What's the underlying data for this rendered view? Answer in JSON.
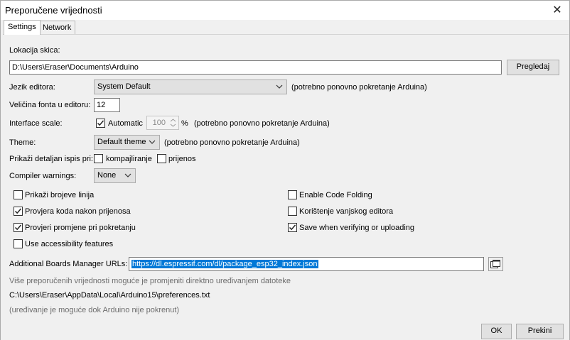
{
  "window": {
    "title": "Preporučene vrijednosti"
  },
  "tabs": [
    {
      "label": "Settings",
      "active": true
    },
    {
      "label": "Network",
      "active": false
    }
  ],
  "sketchbook": {
    "label": "Lokacija skica:",
    "value": "D:\\Users\\Eraser\\Documents\\Arduino",
    "browse_label": "Pregledaj"
  },
  "language": {
    "label": "Jezik editora:",
    "value": "System Default",
    "note": "(potrebno ponovno pokretanje Arduina)"
  },
  "font_size": {
    "label": "Veličina fonta u editoru:",
    "value": "12"
  },
  "interface_scale": {
    "label": "Interface scale:",
    "automatic_label": "Automatic",
    "automatic_checked": true,
    "value": "100",
    "unit": "%",
    "note": "(potrebno ponovno pokretanje Arduina)"
  },
  "theme": {
    "label": "Theme:",
    "value": "Default theme",
    "note": "(potrebno ponovno pokretanje Arduina)"
  },
  "verbose": {
    "label": "Prikaži detaljan ispis pri:",
    "compile_label": "kompajliranje",
    "compile_checked": false,
    "upload_label": "prijenos",
    "upload_checked": false
  },
  "compiler_warnings": {
    "label": "Compiler warnings:",
    "value": "None"
  },
  "options_left": [
    {
      "label": "Prikaži brojeve linija",
      "checked": false
    },
    {
      "label": "Provjera koda nakon prijenosa",
      "checked": true
    },
    {
      "label": "Provjeri promjene pri pokretanju",
      "checked": true
    },
    {
      "label": "Use accessibility features",
      "checked": false
    }
  ],
  "options_right": [
    {
      "label": "Enable Code Folding",
      "checked": false
    },
    {
      "label": "Korištenje vanjskog editora",
      "checked": false
    },
    {
      "label": "Save when verifying or uploading",
      "checked": true
    }
  ],
  "boards_manager": {
    "label": "Additional Boards Manager URLs:",
    "value": "https://dl.espressif.com/dl/package_esp32_index.json"
  },
  "footer_notes": {
    "more_prefs": "Više preporučenih vrijednosti moguće je promjeniti direktno uređivanjem datoteke",
    "prefs_path": "C:\\Users\\Eraser\\AppData\\Local\\Arduino15\\preferences.txt",
    "edit_note": "(uređivanje je moguće dok Arduino nije pokrenut)"
  },
  "buttons": {
    "ok_label": "OK",
    "cancel_label": "Prekini"
  },
  "colors": {
    "selection": "#0078d7",
    "background": "#f0f0f0"
  }
}
